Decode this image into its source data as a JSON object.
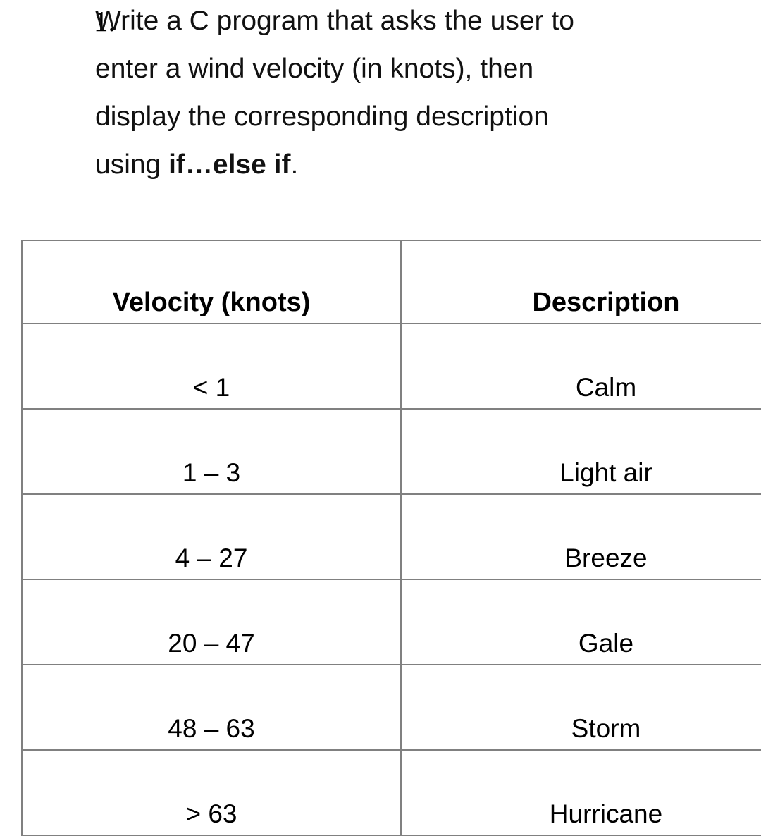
{
  "document": {
    "question": {
      "marker": "1.",
      "lines": [
        "Write a C program that asks the user to",
        "enter a wind velocity (in knots), then",
        "display the corresponding description"
      ],
      "last_line_prefix": "using ",
      "last_line_bold": "if…else if",
      "last_line_suffix": "."
    },
    "table": {
      "headers": {
        "velocity": "Velocity (knots)",
        "description": "Description"
      },
      "rows": [
        {
          "velocity": "< 1",
          "description": "Calm"
        },
        {
          "velocity": "1 – 3",
          "description": "Light air"
        },
        {
          "velocity": "4 – 27",
          "description": "Breeze"
        },
        {
          "velocity": "20 – 47",
          "description": "Gale"
        },
        {
          "velocity": "48 – 63",
          "description": "Storm"
        },
        {
          "velocity": "> 63",
          "description": "Hurricane"
        }
      ]
    },
    "colors": {
      "text": "#000000",
      "border": "#808080",
      "background": "#ffffff"
    }
  }
}
